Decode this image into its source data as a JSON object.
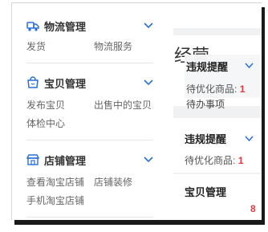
{
  "sidebar": {
    "sections": [
      {
        "title": "物流管理",
        "icon": "truck-icon",
        "links": [
          "发货",
          "物流服务"
        ]
      },
      {
        "title": "宝贝管理",
        "icon": "shopping-bag-icon",
        "links": [
          "发布宝贝",
          "出售中的宝贝",
          "体检中心"
        ]
      },
      {
        "title": "店铺管理",
        "icon": "store-icon",
        "links": [
          "查看淘宝店铺",
          "店铺装修",
          "手机淘宝店铺"
        ]
      }
    ]
  },
  "panel": {
    "heading_fragment": "经营",
    "popup": {
      "title": "违规提醒",
      "label": "待优化商品:",
      "count": "1"
    },
    "under_text": "待办事项",
    "card": {
      "title": "违规提醒",
      "label": "待优化商品:",
      "count": "1"
    },
    "section_title": "宝贝管理",
    "corner_number": "8"
  },
  "colors": {
    "accent": "#2a6fd6",
    "alert": "#e4393c",
    "title": "#333333",
    "link": "#666666"
  }
}
